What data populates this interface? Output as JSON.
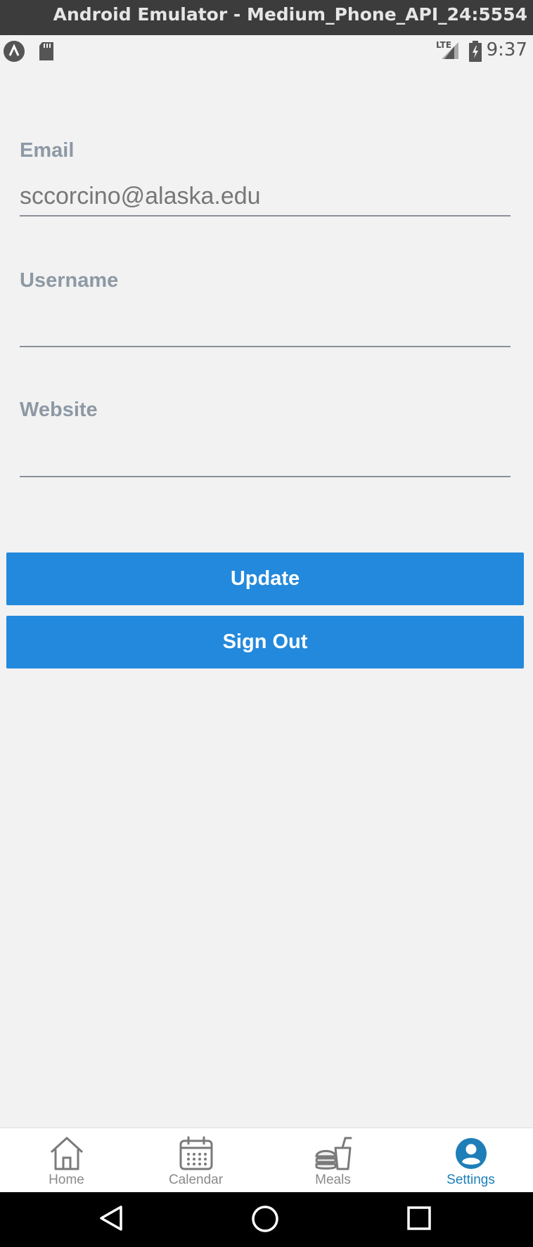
{
  "window": {
    "title": "Android Emulator - Medium_Phone_API_24:5554"
  },
  "status_bar": {
    "time": "9:37",
    "network": "LTE",
    "icons": [
      "app-notification-icon",
      "sd-card-icon",
      "lte-signal-icon",
      "battery-charging-icon"
    ]
  },
  "form": {
    "email": {
      "label": "Email",
      "value": "sccorcino@alaska.edu",
      "placeholder": ""
    },
    "username": {
      "label": "Username",
      "value": "",
      "placeholder": ""
    },
    "website": {
      "label": "Website",
      "value": "",
      "placeholder": ""
    }
  },
  "buttons": {
    "update": "Update",
    "sign_out": "Sign Out"
  },
  "tabs": [
    {
      "label": "Home",
      "icon": "home-icon",
      "active": false
    },
    {
      "label": "Calendar",
      "icon": "calendar-icon",
      "active": false
    },
    {
      "label": "Meals",
      "icon": "meals-icon",
      "active": false
    },
    {
      "label": "Settings",
      "icon": "user-circle-icon",
      "active": true
    }
  ],
  "nav": {
    "back": "back-icon",
    "home": "home-circle-icon",
    "recents": "recents-icon"
  },
  "colors": {
    "primary_button": "#2389dc",
    "active_tab": "#1d7eb8",
    "inactive_tab": "#8a8a8a",
    "label": "#8d99a5",
    "background": "#f2f2f2"
  }
}
